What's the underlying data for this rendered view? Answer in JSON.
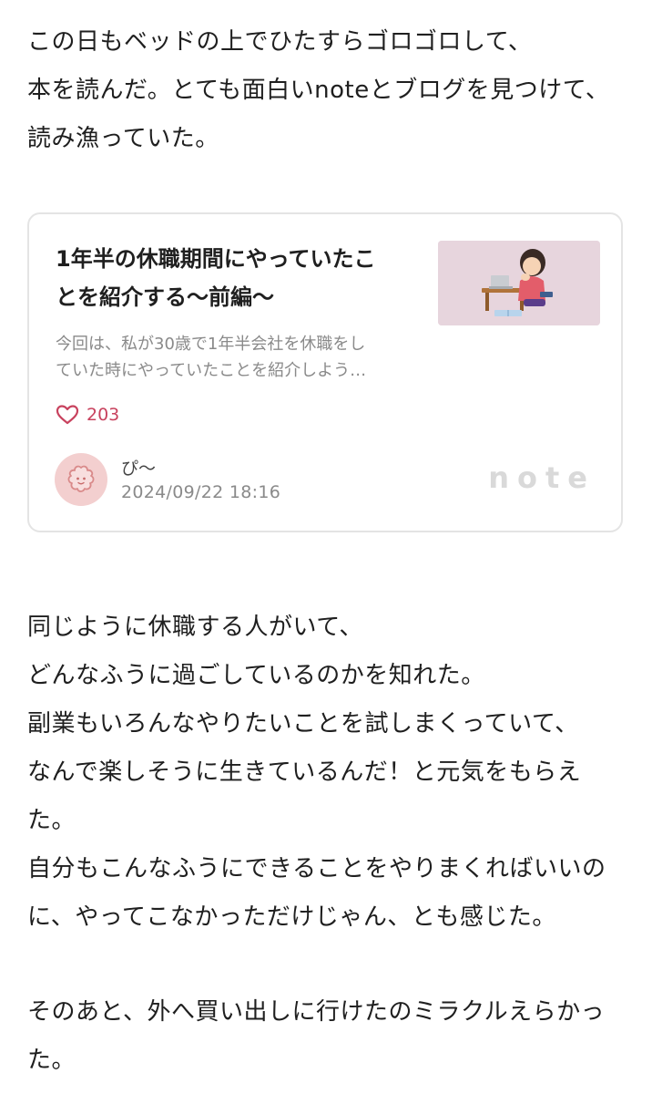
{
  "paragraph1": [
    "この日もベッドの上でひたすらゴロゴロして、",
    "本を読んだ。とても面白いnoteとブログを見つけて、",
    "読み漁っていた。"
  ],
  "link_card": {
    "title_lines": [
      "1年半の休職期間にやっていたこ",
      "とを紹介する〜前編〜"
    ],
    "excerpt_lines": [
      "今回は、私が30歳で1年半会社を休職をし",
      "ていた時にやっていたことを紹介しよう…"
    ],
    "like_count": "203",
    "author": "ぴ〜",
    "date": "2024/09/22 18:16",
    "brand": "note",
    "icons": {
      "like": "heart-outline-icon",
      "avatar": "flower-avatar-icon"
    },
    "colors": {
      "accent": "#c8425e",
      "thumb_bg": "#e7d5dd",
      "avatar_bg": "#f3cfcf",
      "brand": "#d9d9d9"
    }
  },
  "paragraph2": [
    "同じように休職する人がいて、",
    "どんなふうに過ごしているのかを知れた。",
    "副業もいろんなやりたいことを試しまくっていて、",
    "なんで楽しそうに生きているんだ！と元気をもらえ",
    "た。",
    "自分もこんなふうにできることをやりまくればいいの",
    "に、やってこなかっただけじゃん、とも感じた。"
  ],
  "paragraph3": [
    "そのあと、外へ買い出しに行けたのミラクルえらかっ",
    "た。"
  ]
}
